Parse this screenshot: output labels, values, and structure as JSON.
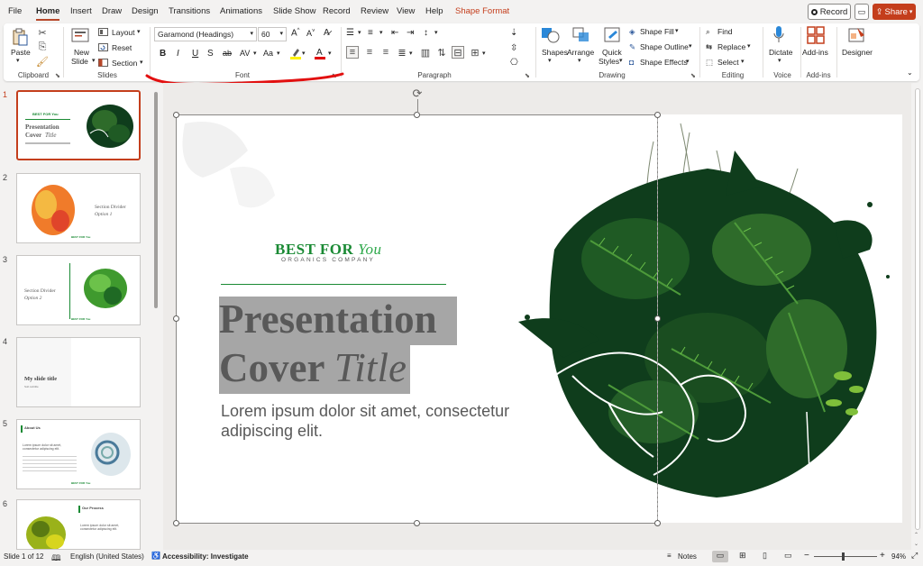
{
  "menubar": {
    "tabs": [
      "File",
      "Home",
      "Insert",
      "Draw",
      "Design",
      "Transitions",
      "Animations",
      "Slide Show",
      "Record",
      "Review",
      "View",
      "Help",
      "Shape Format"
    ],
    "record_label": "Record",
    "share_label": "Share"
  },
  "ribbon": {
    "clipboard": {
      "paste": "Paste",
      "label": "Clipboard"
    },
    "slides": {
      "new_slide_1": "New",
      "new_slide_2": "Slide",
      "layout": "Layout",
      "reset": "Reset",
      "section": "Section",
      "label": "Slides"
    },
    "font": {
      "font_name": "Garamond (Headings)",
      "font_size": "60",
      "bold": "B",
      "italic": "I",
      "underline": "U",
      "strike": "S",
      "shadow": "ab",
      "spacing": "AV",
      "case": "Aa",
      "label": "Font"
    },
    "paragraph": {
      "label": "Paragraph"
    },
    "drawing": {
      "shapes": "Shapes",
      "arrange": "Arrange",
      "quick_styles_1": "Quick",
      "quick_styles_2": "Styles",
      "shape_fill": "Shape Fill",
      "shape_outline": "Shape Outline",
      "shape_effects": "Shape Effects",
      "label": "Drawing"
    },
    "editing": {
      "find": "Find",
      "replace": "Replace",
      "select": "Select",
      "label": "Editing"
    },
    "voice": {
      "dictate": "Dictate",
      "label": "Voice"
    },
    "addins": {
      "addins": "Add-ins",
      "label": "Add-ins"
    },
    "designer": {
      "label": "Designer"
    }
  },
  "thumbnails": [
    {
      "num": "1",
      "line1": "Presentation",
      "line2": "Cover",
      "line3": "Title",
      "brand": "BEST FOR You"
    },
    {
      "num": "2",
      "line1": "Section Divider",
      "line2": "Option 1",
      "brand": "BEST FOR You"
    },
    {
      "num": "3",
      "line1": "Section Divider",
      "line2": "Option 2",
      "brand": "BEST FOR You"
    },
    {
      "num": "4",
      "line1": "My slide title",
      "line2": "Sub subtitle"
    },
    {
      "num": "5",
      "line1": "About Us",
      "line2": "Lorem ipsum dolor sit amet, consectetur adipiscing elit.",
      "brand": "BEST FOR You"
    },
    {
      "num": "6",
      "line1": "Our Process",
      "line2": "Lorem ipsum dolor sit amet, consectetur adipiscing elit."
    }
  ],
  "slide": {
    "brand_main": "BEST FOR",
    "brand_italic": "You",
    "brand_sub": "ORGANICS COMPANY",
    "title_line1": "Presentation",
    "title_line2_a": "Cover",
    "title_line2_b": "Title",
    "subtitle": "Lorem ipsum dolor sit amet, consectetur adipiscing elit."
  },
  "status": {
    "slide_of": "Slide 1 of 12",
    "language": "English (United States)",
    "accessibility": "Accessibility: Investigate",
    "notes": "Notes",
    "zoom": "94%"
  },
  "colors": {
    "accent": "#c43e1c",
    "brand_green": "#1a8a34",
    "leaf_dark": "#0f3d1c",
    "leaf_mid": "#2e6b2a",
    "title_gray": "#595959"
  }
}
